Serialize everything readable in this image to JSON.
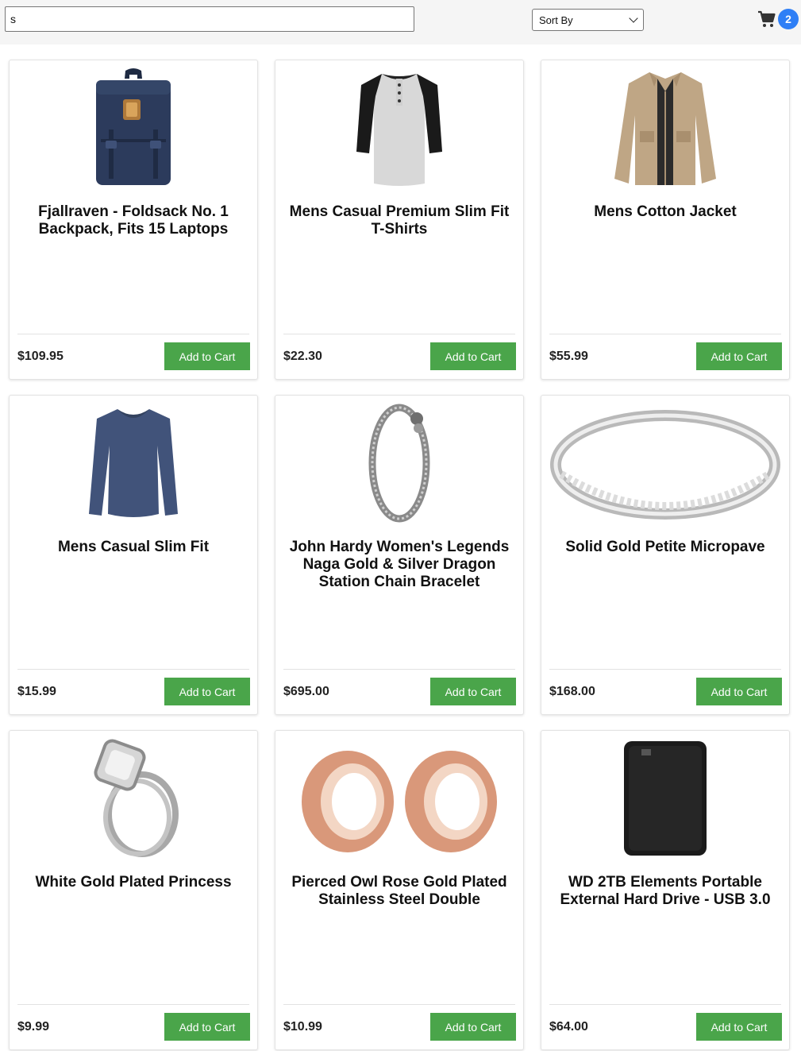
{
  "header": {
    "search_value": "s",
    "sort_label": "Sort By",
    "cart_count": "2"
  },
  "products": [
    {
      "title": "Fjallraven - Foldsack No. 1 Backpack, Fits 15 Laptops",
      "price": "$109.95",
      "button": "Add to Cart",
      "image": "backpack"
    },
    {
      "title": "Mens Casual Premium Slim Fit T-Shirts",
      "price": "$22.30",
      "button": "Add to Cart",
      "image": "tshirt"
    },
    {
      "title": "Mens Cotton Jacket",
      "price": "$55.99",
      "button": "Add to Cart",
      "image": "jacket"
    },
    {
      "title": "Mens Casual Slim Fit",
      "price": "$15.99",
      "button": "Add to Cart",
      "image": "longsleeve"
    },
    {
      "title": "John Hardy Women's Legends Naga Gold & Silver Dragon Station Chain Bracelet",
      "price": "$695.00",
      "button": "Add to Cart",
      "image": "bracelet"
    },
    {
      "title": "Solid Gold Petite Micropave",
      "price": "$168.00",
      "button": "Add to Cart",
      "image": "ring"
    },
    {
      "title": "White Gold Plated Princess",
      "price": "$9.99",
      "button": "Add to Cart",
      "image": "engagement-ring"
    },
    {
      "title": "Pierced Owl Rose Gold Plated Stainless Steel Double",
      "price": "$10.99",
      "button": "Add to Cart",
      "image": "ear-plugs"
    },
    {
      "title": "WD 2TB Elements Portable External Hard Drive - USB 3.0",
      "price": "$64.00",
      "button": "Add to Cart",
      "image": "hard-drive"
    }
  ]
}
